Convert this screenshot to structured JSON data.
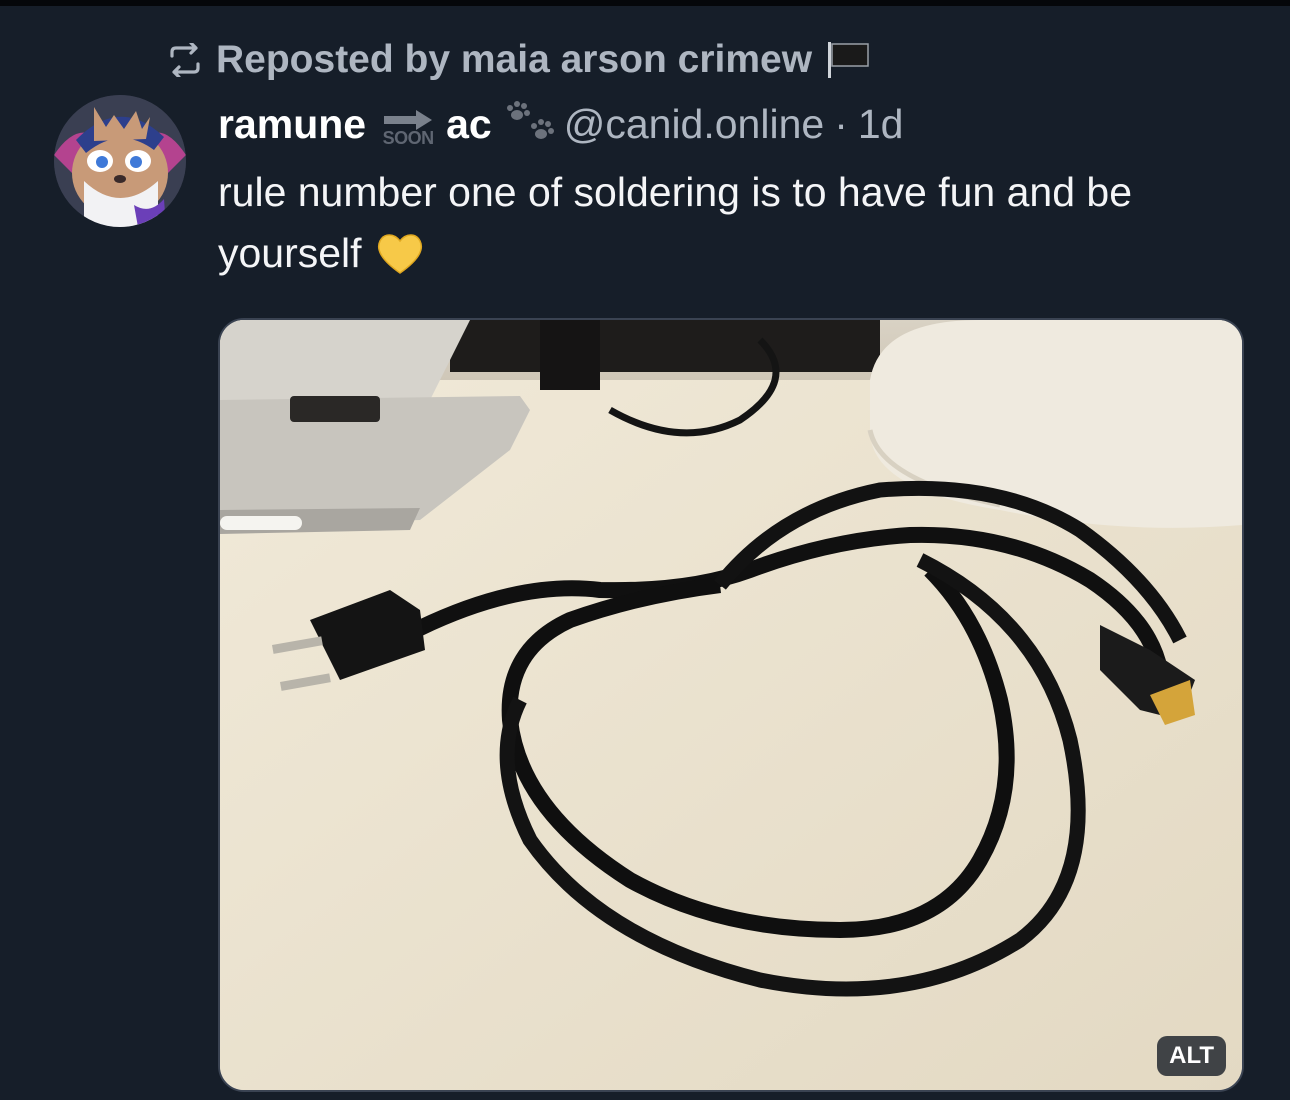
{
  "repost": {
    "icon": "repost-icon",
    "text": "Reposted by maia arson crimew",
    "flag_icon": "flag-icon"
  },
  "author": {
    "display_name_part1": "ramune",
    "soon_label": "SOON",
    "display_name_part2": "ac",
    "handle": "@canid.online",
    "separator": "·",
    "time": "1d"
  },
  "post": {
    "text": "rule number one of soldering is to have fun and be yourself",
    "emoji": "yellow-heart",
    "image_alt_label": "ALT"
  },
  "colors": {
    "background": "#161e29",
    "muted_text": "#aeb6c1",
    "primary_text": "#f4f5f7",
    "heart": "#f7c948"
  }
}
